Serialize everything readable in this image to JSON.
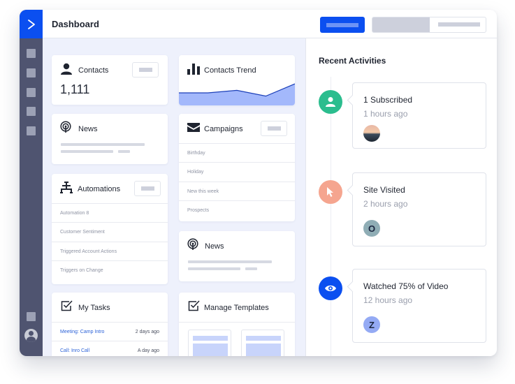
{
  "header": {
    "title": "Dashboard"
  },
  "sidebar": {
    "logo_icon": "chevron-right-icon",
    "items": [
      "nav-square-icon",
      "nav-square-icon",
      "nav-square-icon",
      "nav-square-icon",
      "nav-square-icon"
    ],
    "bottom_item": "nav-square-icon",
    "profile_icon": "user-avatar-icon"
  },
  "cards": {
    "contacts": {
      "title": "Contacts",
      "value": "1,111",
      "icon": "person-icon"
    },
    "news_left": {
      "title": "News",
      "icon": "podcast-icon"
    },
    "automations": {
      "title": "Automations",
      "icon": "hierarchy-icon",
      "items": [
        "Automation 8",
        "Customer Sentiment",
        "Triggered Account Actions",
        "Triggers on Change"
      ]
    },
    "my_tasks": {
      "title": "My Tasks",
      "icon": "checkbox-icon",
      "items": [
        {
          "label": "Meeting: Camp Intro",
          "time": "2 days ago"
        },
        {
          "label": "Call: Inro Call",
          "time": "A day ago"
        }
      ]
    },
    "contacts_trend": {
      "title": "Contacts Trend",
      "icon": "bar-chart-icon",
      "trend_values": [
        35,
        35,
        42,
        26,
        60
      ],
      "fill_color": "#a3b8fb",
      "line_color": "#1b3fb8"
    },
    "campaigns": {
      "title": "Campaigns",
      "icon": "envelope-icon",
      "items": [
        "Birthday",
        "Holiday",
        "New this week",
        "Prospects"
      ]
    },
    "news_right": {
      "title": "News",
      "icon": "podcast-icon"
    },
    "manage_templates": {
      "title": "Manage Templates",
      "icon": "checkbox-icon"
    }
  },
  "activities": {
    "title": "Recent Activities",
    "items": [
      {
        "title": "1 Subscribed",
        "time": "1 hours ago",
        "icon": "person-icon",
        "color": "#2bbd8e",
        "avatar": "",
        "avatar_kind": "photo"
      },
      {
        "title": "Site Visited",
        "time": "2 hours ago",
        "icon": "cursor-icon",
        "color": "#f5a58f",
        "avatar": "O",
        "avatar_color": "#8fadb5"
      },
      {
        "title": "Watched 75% of Video",
        "time": "12 hours ago",
        "icon": "eye-icon",
        "color": "#0b4ff0",
        "avatar": "Z",
        "avatar_color": "#94aaf4"
      }
    ]
  },
  "colors": {
    "brand": "#0b4ff0",
    "sidebar": "#4f5470",
    "canvas": "#eef1fc",
    "link": "#2c62d8"
  }
}
